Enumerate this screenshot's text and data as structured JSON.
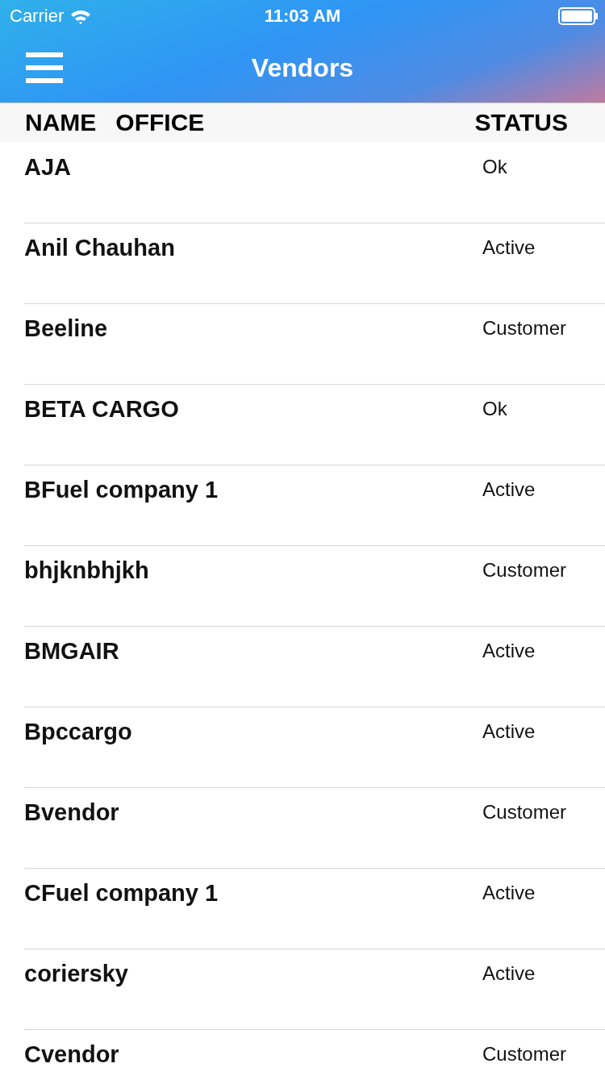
{
  "status_bar": {
    "carrier": "Carrier",
    "time": "11:03 AM"
  },
  "nav": {
    "title": "Vendors"
  },
  "table": {
    "columns": [
      "NAME",
      "OFFICE",
      "STATUS"
    ],
    "rows": [
      {
        "name": "AJA",
        "status": "Ok"
      },
      {
        "name": "Anil Chauhan",
        "status": "Active"
      },
      {
        "name": "Beeline",
        "status": "Customer"
      },
      {
        "name": "BETA CARGO",
        "status": "Ok"
      },
      {
        "name": "BFuel company 1",
        "status": "Active"
      },
      {
        "name": "bhjknbhjkh",
        "status": "Customer"
      },
      {
        "name": "BMGAIR",
        "status": "Active"
      },
      {
        "name": "Bpccargo",
        "status": "Active"
      },
      {
        "name": "Bvendor",
        "status": "Customer"
      },
      {
        "name": "CFuel company 1",
        "status": "Active"
      },
      {
        "name": "coriersky",
        "status": "Active"
      },
      {
        "name": "Cvendor",
        "status": "Customer"
      }
    ]
  }
}
